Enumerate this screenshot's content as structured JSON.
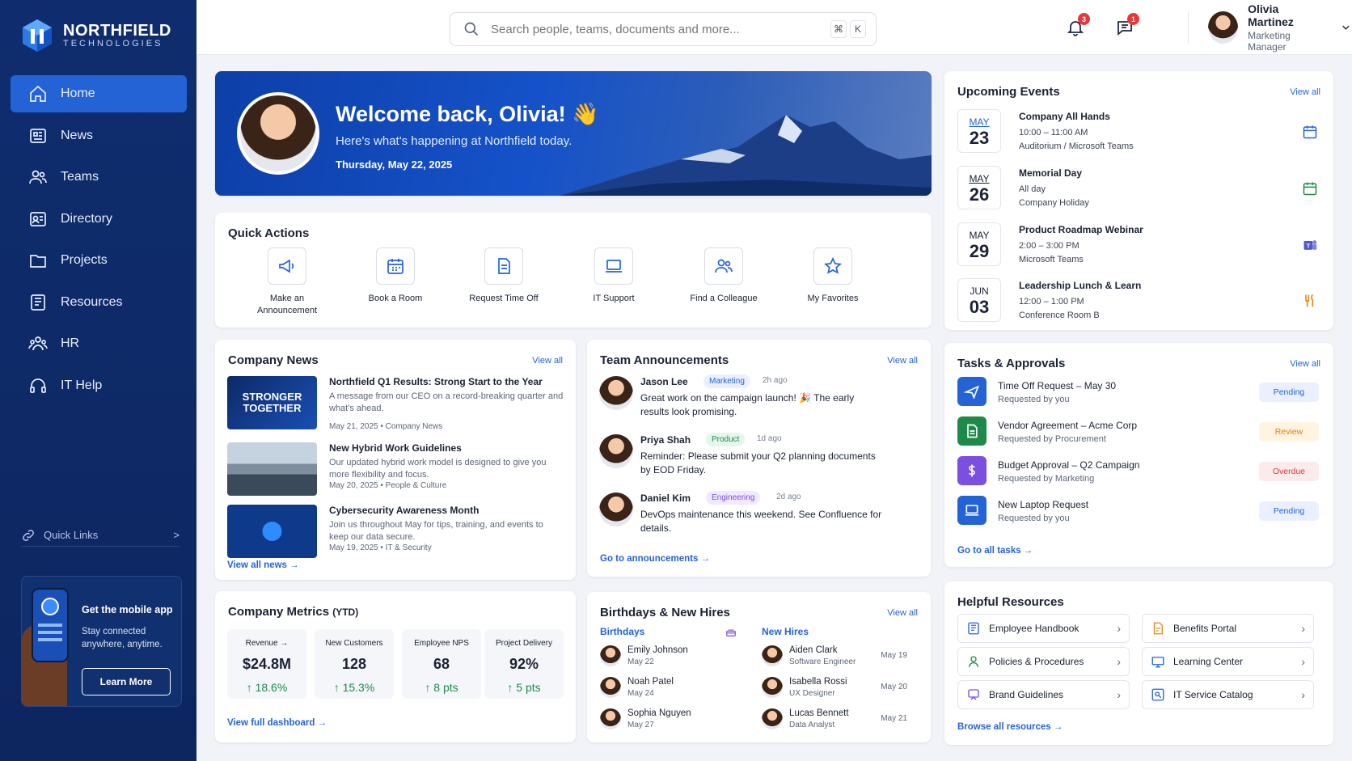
{
  "brand": {
    "name": "NORTHFIELD",
    "sub": "TECHNOLOGIES"
  },
  "nav": [
    {
      "label": "Home",
      "icon": "home-icon"
    },
    {
      "label": "News",
      "icon": "news-icon"
    },
    {
      "label": "Teams",
      "icon": "teams-icon"
    },
    {
      "label": "Directory",
      "icon": "directory-icon"
    },
    {
      "label": "Projects",
      "icon": "folder-icon"
    },
    {
      "label": "Resources",
      "icon": "book-icon"
    },
    {
      "label": "HR",
      "icon": "people-icon"
    },
    {
      "label": "IT Help",
      "icon": "headset-icon"
    }
  ],
  "quick_links": {
    "label": "Quick Links",
    "chev": ">"
  },
  "mobile": {
    "title": "Get the mobile app",
    "sub": "Stay connected anywhere, anytime.",
    "button": "Learn More"
  },
  "search": {
    "placeholder": "Search people, teams, documents and more...",
    "k1": "⌘",
    "k2": "K"
  },
  "notifications": {
    "bell_count": "3",
    "chat_count": "1"
  },
  "user": {
    "name": "Olivia Martinez",
    "role": "Marketing Manager"
  },
  "hero": {
    "title": "Welcome back, Olivia! 👋",
    "sub": "Here's what's happening at Northfield today.",
    "date": "Thursday, May 22, 2025"
  },
  "quick_actions": {
    "title": "Quick Actions",
    "items": [
      {
        "label": "Make an Announcement",
        "icon": "megaphone-icon"
      },
      {
        "label": "Book a Room",
        "icon": "calendar-icon"
      },
      {
        "label": "Request Time Off",
        "icon": "document-icon"
      },
      {
        "label": "IT Support",
        "icon": "laptop-icon"
      },
      {
        "label": "Find a Colleague",
        "icon": "people-icon"
      },
      {
        "label": "My Favorites",
        "icon": "star-icon"
      }
    ]
  },
  "news": {
    "title": "Company News",
    "view_all": "View all",
    "footer": "View all news →",
    "thumb_text": "STRONGER TOGETHER",
    "items": [
      {
        "title": "Northfield Q1 Results: Strong Start to the Year",
        "desc": "A message from our CEO on a record-breaking quarter and what's ahead.",
        "meta": "May 21, 2025  •  Company News"
      },
      {
        "title": "New Hybrid Work Guidelines",
        "desc": "Our updated hybrid work model is designed to give you more flexibility and focus.",
        "meta": "May 20, 2025  •  People & Culture"
      },
      {
        "title": "Cybersecurity Awareness Month",
        "desc": "Join us throughout May for tips, training, and events to keep our data secure.",
        "meta": "May 19, 2025  •  IT & Security"
      }
    ]
  },
  "announcements": {
    "title": "Team Announcements",
    "view_all": "View all",
    "footer": "Go to announcements →",
    "items": [
      {
        "name": "Jason Lee",
        "tag": "Marketing",
        "ago": "2h ago",
        "text": "Great work on the campaign launch! 🎉 The early results look promising."
      },
      {
        "name": "Priya Shah",
        "tag": "Product",
        "ago": "1d ago",
        "text": "Reminder: Please submit your Q2 planning documents by EOD Friday."
      },
      {
        "name": "Daniel Kim",
        "tag": "Engineering",
        "ago": "2d ago",
        "text": "DevOps maintenance this weekend. See Confluence for details."
      }
    ]
  },
  "metrics": {
    "title": "Company Metrics",
    "title_suffix": "(YTD)",
    "footer": "View full dashboard →",
    "items": [
      {
        "label": "Revenue →",
        "value": "$24.8M",
        "delta": "↑ 18.6%"
      },
      {
        "label": "New Customers",
        "value": "128",
        "delta": "↑ 15.3%"
      },
      {
        "label": "Employee NPS",
        "value": "68",
        "delta": "↑ 8 pts"
      },
      {
        "label": "Project Delivery",
        "value": "92%",
        "delta": "↑ 5 pts"
      }
    ]
  },
  "birthdays": {
    "title": "Birthdays & New Hires",
    "view_all": "View all",
    "bday_label": "Birthdays",
    "hires_label": "New Hires",
    "bdays": [
      {
        "name": "Emily Johnson",
        "date": "May 22"
      },
      {
        "name": "Noah Patel",
        "date": "May 24"
      },
      {
        "name": "Sophia Nguyen",
        "date": "May 27"
      }
    ],
    "hires": [
      {
        "name": "Aiden Clark",
        "role": "Software Engineer",
        "date": "May 19"
      },
      {
        "name": "Isabella Rossi",
        "role": "UX Designer",
        "date": "May 20"
      },
      {
        "name": "Lucas Bennett",
        "role": "Data Analyst",
        "date": "May 21"
      }
    ]
  },
  "events": {
    "title": "Upcoming Events",
    "view_all": "View all",
    "items": [
      {
        "mon": "MAY",
        "day": "23",
        "title": "Company All Hands",
        "line1": "10:00 – 11:00 AM",
        "line2": "Auditorium / Microsoft Teams",
        "icon": "calendar-icon",
        "color": "#2463d6"
      },
      {
        "mon": "MAY",
        "day": "26",
        "title": "Memorial Day",
        "line1": "All day",
        "line2": "Company Holiday",
        "icon": "calendar-icon",
        "color": "#1e8a49"
      },
      {
        "mon": "MAY",
        "day": "29",
        "title": "Product Roadmap Webinar",
        "line1": "2:00 – 3:00 PM",
        "line2": "Microsoft Teams",
        "icon": "teams-icon",
        "color": "#5059c9"
      },
      {
        "mon": "JUN",
        "day": "03",
        "title": "Leadership Lunch & Learn",
        "line1": "12:00 – 1:00 PM",
        "line2": "Conference Room B",
        "icon": "utensils-icon",
        "color": "#e08a1e"
      }
    ]
  },
  "tasks": {
    "title": "Tasks & Approvals",
    "view_all": "View all",
    "footer": "Go to all tasks →",
    "items": [
      {
        "title": "Time Off Request – May 30",
        "sub": "Requested by you",
        "status": "Pending",
        "icon": "plane-icon",
        "color": "#2463d6"
      },
      {
        "title": "Vendor Agreement – Acme Corp",
        "sub": "Requested by Procurement",
        "status": "Review",
        "icon": "document-icon",
        "color": "#1e8a49"
      },
      {
        "title": "Budget Approval – Q2 Campaign",
        "sub": "Requested by Marketing",
        "status": "Overdue",
        "icon": "dollar-icon",
        "color": "#7b4fe0"
      },
      {
        "title": "New Laptop Request",
        "sub": "Requested by you",
        "status": "Pending",
        "icon": "laptop-icon",
        "color": "#2463d6"
      }
    ]
  },
  "resources": {
    "title": "Helpful Resources",
    "footer": "Browse all resources →",
    "items": [
      {
        "label": "Employee Handbook",
        "icon": "book-icon"
      },
      {
        "label": "Benefits Portal",
        "icon": "benefits-icon"
      },
      {
        "label": "Policies & Procedures",
        "icon": "policy-icon"
      },
      {
        "label": "Learning Center",
        "icon": "learning-icon"
      },
      {
        "label": "Brand Guidelines",
        "icon": "brand-icon"
      },
      {
        "label": "IT Service Catalog",
        "icon": "catalog-icon"
      }
    ]
  }
}
